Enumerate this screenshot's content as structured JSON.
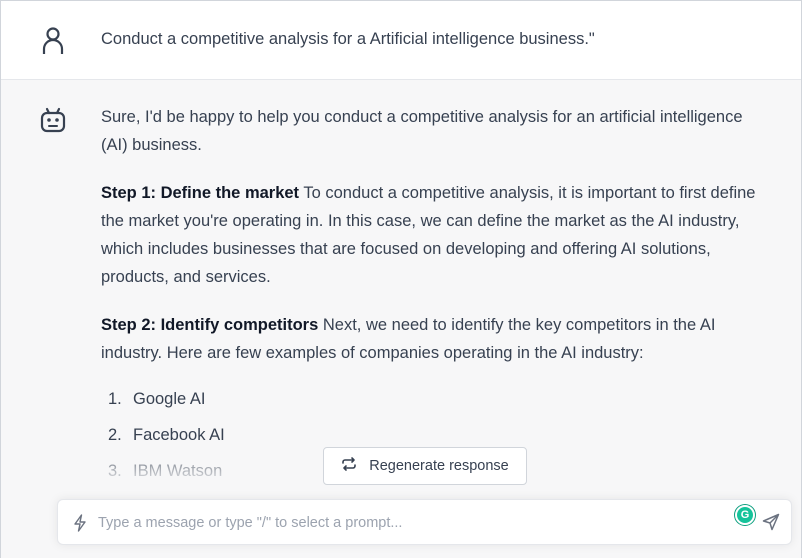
{
  "user_message": {
    "text": "Conduct a competitive analysis for a Artificial intelligence business.\""
  },
  "assistant_message": {
    "intro": "Sure, I'd be happy to help you conduct a competitive analysis for an artificial intelligence (AI) business.",
    "step1": {
      "heading": "Step 1: Define the market",
      "body": " To conduct a competitive analysis, it is important to first define the market you're operating in. In this case, we can define the market as the AI industry, which includes businesses that are focused on developing and offering AI solutions, products, and services."
    },
    "step2": {
      "heading": "Step 2: Identify competitors",
      "body": " Next, we need to identify the key competitors in the AI industry. Here are few examples of companies operating in the AI industry:"
    },
    "competitors": [
      {
        "num": "1.",
        "name": "Google AI"
      },
      {
        "num": "2.",
        "name": "Facebook AI"
      },
      {
        "num": "3.",
        "name": "IBM Watson"
      }
    ]
  },
  "regenerate": {
    "label": "Regenerate response"
  },
  "composer": {
    "placeholder": "Type a message or type \"/\" to select a prompt...",
    "value": ""
  },
  "icons": {
    "user": "user-icon",
    "bot": "robot-icon",
    "regenerate": "refresh-icon",
    "prompt": "lightning-bolt-icon",
    "grammarly": "grammarly-icon",
    "send": "send-icon"
  },
  "colors": {
    "grammarly": "#15c39a",
    "text": "#374151",
    "background": "#f7f7f8"
  }
}
